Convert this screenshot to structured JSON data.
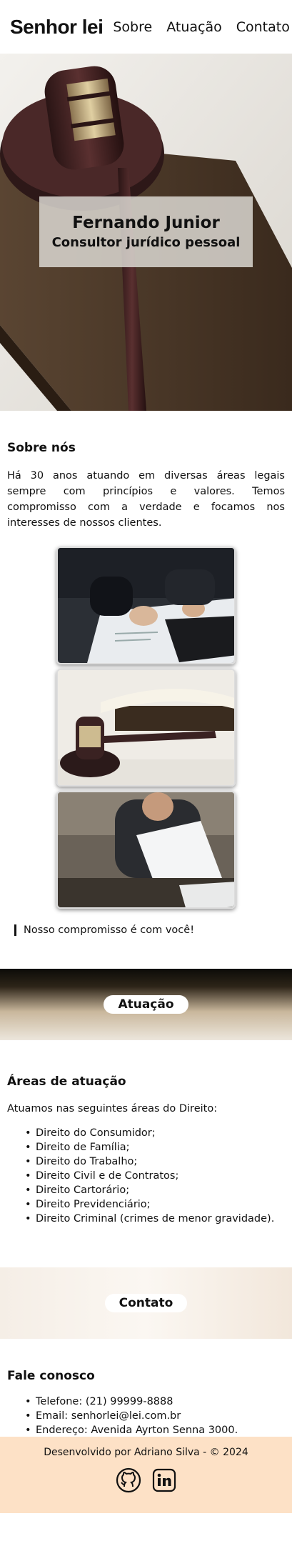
{
  "header": {
    "logo": "Senhor lei",
    "nav": [
      "Sobre",
      "Atuação",
      "Contato"
    ]
  },
  "hero": {
    "name": "Fernando Junior",
    "subtitle": "Consultor jurídico pessoal"
  },
  "about": {
    "title": "Sobre nós",
    "text": "Há 30 anos atuando em diversas áreas legais sempre com princípios e valores. Temos compromisso com a verdade e focamos nos interesses de nossos clientes.",
    "quote": "Nosso compromisso é com você!"
  },
  "banner_atuacao": "Atuação",
  "areas": {
    "title": "Áreas de atuação",
    "intro": "Atuamos nas seguintes áreas do Direito:",
    "items": [
      "Direito do Consumidor;",
      "Direito de Família;",
      "Direito do Trabalho;",
      "Direito Civil e de Contratos;",
      "Direito Cartorário;",
      "Direito Previdenciário;",
      "Direito Criminal (crimes de menor gravidade)."
    ]
  },
  "banner_contato": "Contato",
  "contact": {
    "title": "Fale conosco",
    "items": [
      "Telefone: (21) 99999-8888",
      "Email: senhorlei@lei.com.br",
      "Endereço: Avenida Ayrton Senna 3000."
    ]
  },
  "footer": {
    "text": "Desenvolvido por Adriano Silva - © 2024",
    "icons": [
      "github-icon",
      "linkedin-icon"
    ]
  }
}
